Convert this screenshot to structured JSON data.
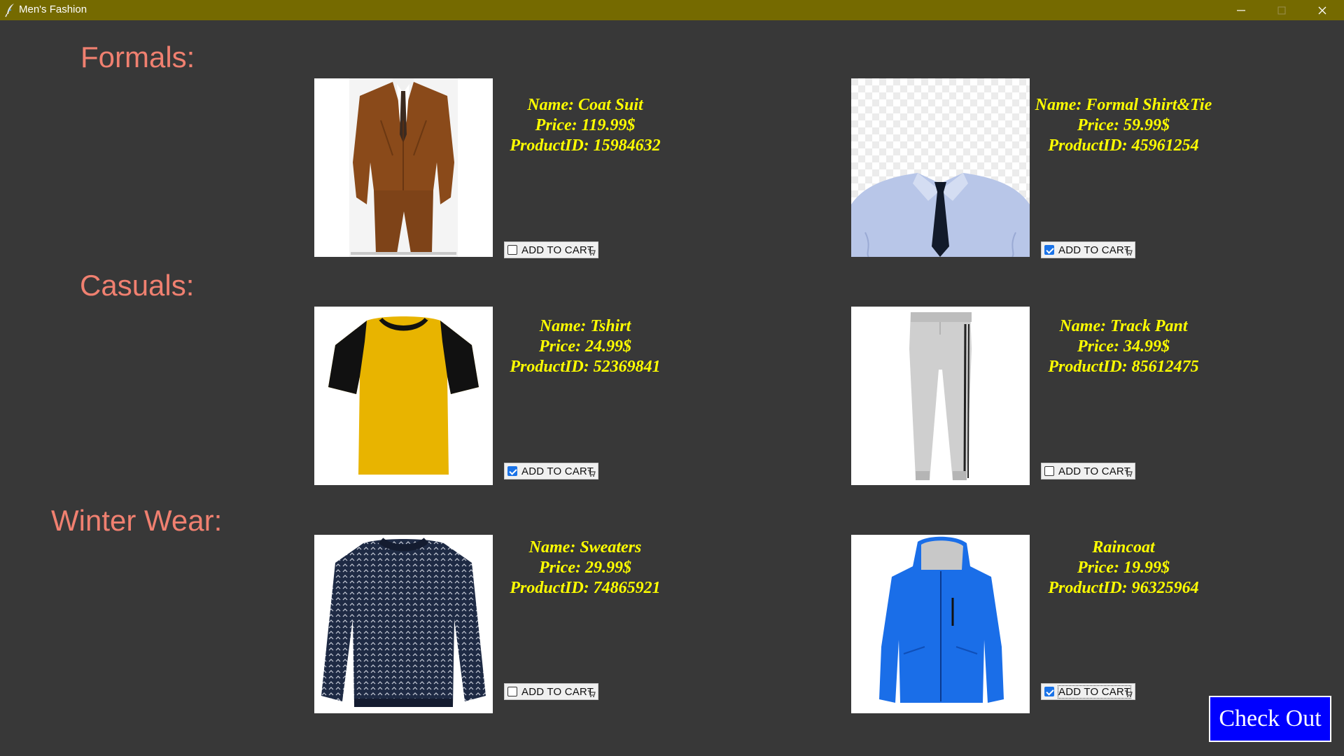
{
  "window": {
    "title": "Men's Fashion",
    "controls": [
      "minimize-icon",
      "maximize-icon",
      "close-icon"
    ],
    "titlebar_color": "#756a00",
    "background_color": "#383838"
  },
  "colors": {
    "section_title": "#f08070",
    "product_text": "#ffff00",
    "checkout_bg": "#0000ff",
    "checkbox_checked": "#1a73e8"
  },
  "sections": [
    {
      "title": "Formals:",
      "products": [
        {
          "name_line": "Name: Coat Suit",
          "price_line": "Price: 119.99$",
          "id_line": "ProductID: 15984632",
          "image": "brown-coat-suit-image",
          "cart_label": "ADD TO CART",
          "checked": false
        },
        {
          "name_line": "Name: Formal Shirt&Tie",
          "price_line": "Price: 59.99$",
          "id_line": "ProductID: 45961254",
          "image": "formal-shirt-tie-image",
          "cart_label": "ADD TO CART",
          "checked": true
        }
      ]
    },
    {
      "title": "Casuals:",
      "products": [
        {
          "name_line": "Name: Tshirt",
          "price_line": "Price: 24.99$",
          "id_line": "ProductID: 52369841",
          "image": "yellow-tshirt-image",
          "cart_label": "ADD TO CART",
          "checked": true
        },
        {
          "name_line": "Name: Track Pant",
          "price_line": "Price: 34.99$",
          "id_line": "ProductID: 85612475",
          "image": "grey-track-pant-image",
          "cart_label": "ADD TO CART",
          "checked": false
        }
      ]
    },
    {
      "title": "Winter Wear:",
      "products": [
        {
          "name_line": "Name: Sweaters",
          "price_line": "Price: 29.99$",
          "id_line": "ProductID: 74865921",
          "image": "knit-sweater-image",
          "cart_label": "ADD TO CART",
          "checked": false
        },
        {
          "name_line": "Raincoat",
          "price_line": "Price: 19.99$",
          "id_line": "ProductID: 96325964",
          "image": "blue-raincoat-image",
          "cart_label": "ADD TO CART",
          "checked": true
        }
      ]
    }
  ],
  "checkout": {
    "label": "Check Out"
  }
}
